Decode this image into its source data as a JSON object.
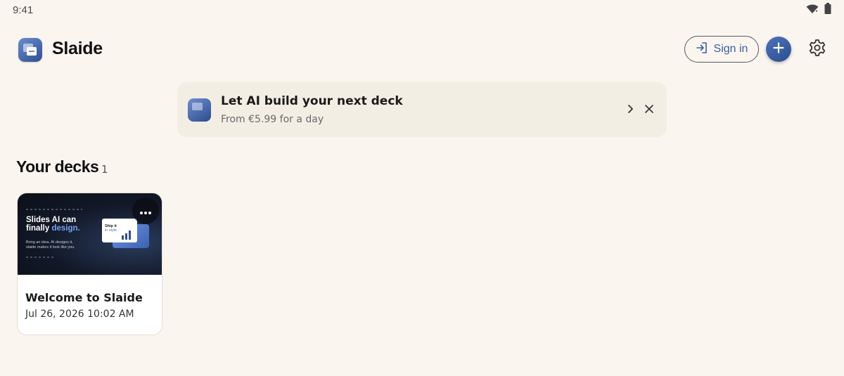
{
  "status_bar": {
    "time": "9:41",
    "icons": [
      "wifi-icon",
      "battery-icon"
    ]
  },
  "header": {
    "app_name": "Slaide",
    "sign_in_label": "Sign in",
    "icons": [
      "app-logo",
      "sign-in-icon",
      "plus-icon",
      "gear-icon"
    ]
  },
  "banner": {
    "title": "Let AI build your next deck",
    "subtitle": "From €5.99 for a day",
    "icons": [
      "chevron-right-icon",
      "close-icon"
    ]
  },
  "decks": {
    "section_title": "Your decks",
    "count": "1",
    "items": [
      {
        "title": "Welcome to Slaide",
        "date": "Jul 26, 2026 10:02 AM",
        "thumbnail": {
          "headline_line1": "Slides AI can",
          "headline_line2_plain": "finally ",
          "headline_line2_accent": "design.",
          "body_line1": "Bring an idea. AI designs it,",
          "body_line2": "slaide makes it look like you.",
          "card_line1": "Ship it",
          "card_line2": "in style."
        }
      }
    ]
  },
  "colors": {
    "background": "#faf5ef",
    "banner_bg": "#f2eee4",
    "accent_blue": "#3a5ea8",
    "card_bg": "#ffffff"
  }
}
